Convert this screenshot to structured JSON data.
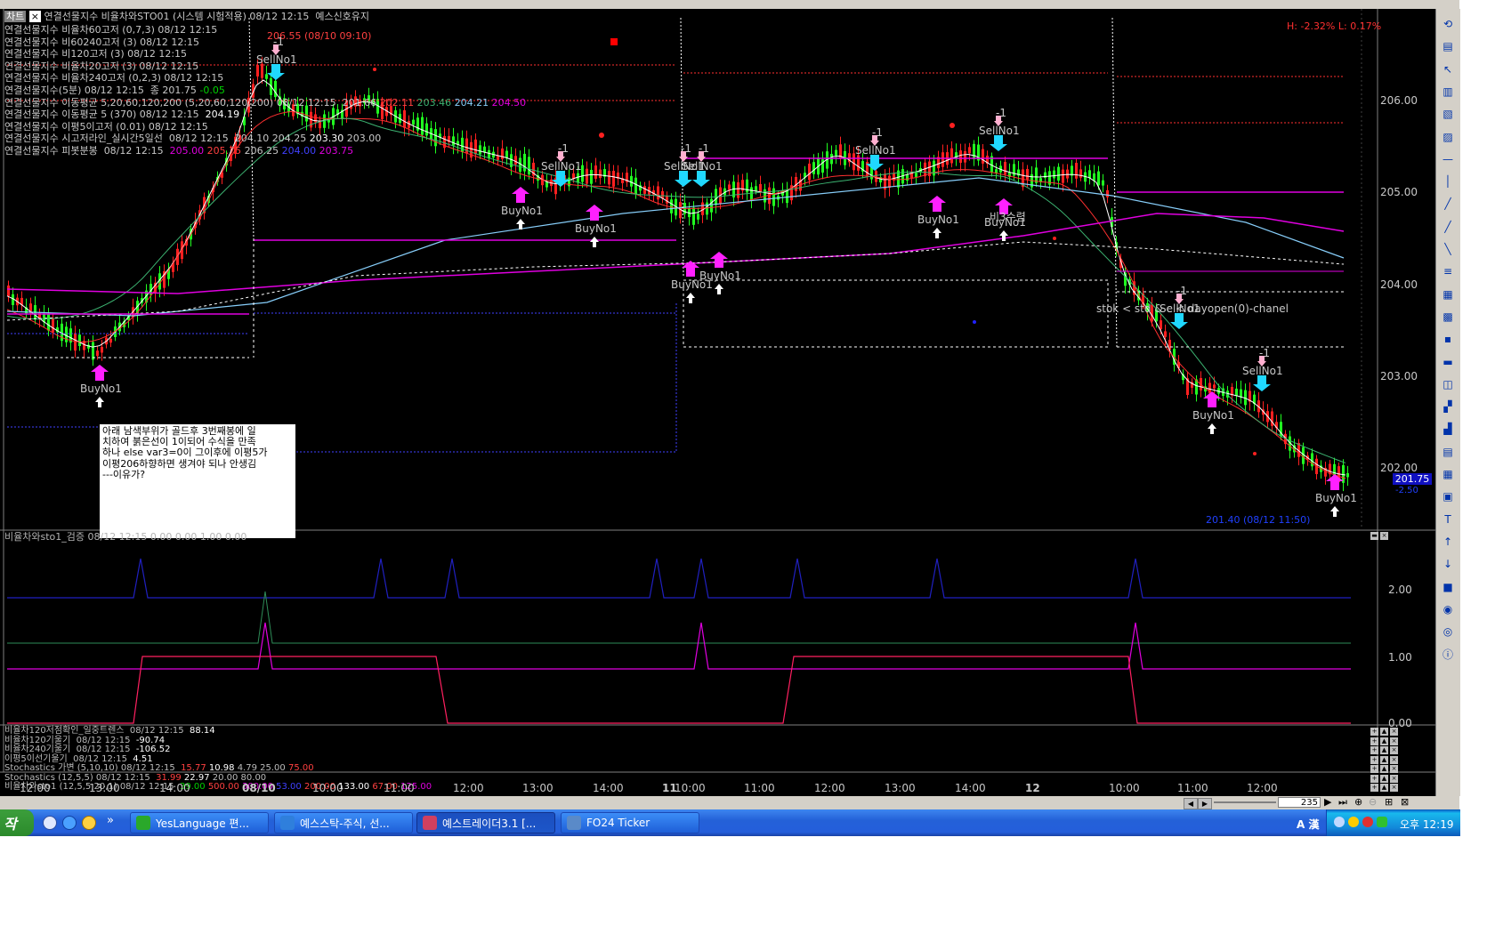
{
  "window": {
    "title_tab": "차트",
    "title_text": "연결선물지수 비율차와STO01 (시스템 시험적용) 08/12 12:15  예스신호유지"
  },
  "legend": [
    {
      "parts": [
        {
          "text": "연결선물지수 비율차60고저 (0,7,3) 08/12 12:15",
          "color": "#c8c8c8"
        }
      ]
    },
    {
      "parts": [
        {
          "text": "연결선물지수 비60240고저 (3) 08/12 12:15",
          "color": "#c8c8c8"
        }
      ]
    },
    {
      "parts": [
        {
          "text": "연결선물지수 비120고저 (3) 08/12 12:15",
          "color": "#c8c8c8"
        }
      ]
    },
    {
      "parts": [
        {
          "text": "연결선물지수 비율차20고저 (3) 08/12 12:15",
          "color": "#c8c8c8"
        }
      ]
    },
    {
      "parts": [
        {
          "text": "연결선물지수 비율차240고저 (0,2,3) 08/12 12:15",
          "color": "#c8c8c8"
        }
      ]
    },
    {
      "parts": [
        {
          "text": "연결선물지수(5분) 08/12 12:15  종 201.75 ",
          "color": "#c8c8c8"
        },
        {
          "text": "-0.05",
          "color": "#00d200"
        }
      ]
    },
    {
      "parts": [
        {
          "text": "연결선물지수 이동평균 5,20,60,120,200 (5,20,60,120,200) 08/12 12:15  201.66 ",
          "color": "#c8c8c8"
        },
        {
          "text": "202.11 ",
          "color": "#ff4040"
        },
        {
          "text": "203.46 ",
          "color": "#3cb371"
        },
        {
          "text": "204.21 ",
          "color": "#87cefa"
        },
        {
          "text": "204.50",
          "color": "#e000e0"
        }
      ]
    },
    {
      "parts": [
        {
          "text": "연결선물지수 이동평균 5 (370) 08/12 12:15  ",
          "color": "#c8c8c8"
        },
        {
          "text": "204.19",
          "color": "#ffffff"
        }
      ]
    },
    {
      "parts": [
        {
          "text": "연결선물지수 이평5이고저 (0.01) 08/12 12:15",
          "color": "#c8c8c8"
        }
      ]
    },
    {
      "parts": [
        {
          "text": "연결선물지수 시고저라인_실시간5일선  08/12 12:15  204.10 204.25 ",
          "color": "#c8c8c8"
        },
        {
          "text": "203.30 ",
          "color": "#ffffff"
        },
        {
          "text": "203.00",
          "color": "#c8c8c8"
        }
      ]
    },
    {
      "parts": [
        {
          "text": "연결선물지수 피봇분봉  08/12 12:15  ",
          "color": "#c8c8c8"
        },
        {
          "text": "205.00 ",
          "color": "#e000e0"
        },
        {
          "text": "205.75 ",
          "color": "#ff4040"
        },
        {
          "text": "206.25 ",
          "color": "#c8c8c8"
        },
        {
          "text": "204.00 ",
          "color": "#4040ff"
        },
        {
          "text": "203.75",
          "color": "#e000e0"
        }
      ]
    }
  ],
  "annotations": {
    "top_price": "206.55 (08/10 09:10)",
    "high_low": "H: -2.32%  L: 0.17%",
    "low_price": "201.40 (08/12 11:50)",
    "current_price": "201.75",
    "current_change": "-2.50",
    "channel_text": "stok < std & c < dayopen(0)-chanel",
    "stop_text": "비3수렴"
  },
  "note": {
    "lines": [
      "아래 남색부위가 골드후 3번째봉에 일",
      "치하여 붉은선이 1이되어 수식을 만족",
      "하나 else var3=0이 그이후에 이평5가",
      "이평206하향하면 생겨야 되나 안생김",
      "---이유가?"
    ]
  },
  "signals": [
    {
      "label": "SellNo1",
      "count": "-1"
    },
    {
      "label": "BuyNo1",
      "count": "1"
    }
  ],
  "price_axis": [
    "206.00",
    "205.00",
    "204.00",
    "203.00",
    "202.00"
  ],
  "indicator_pane": {
    "header": "비율차와sto1_검증  08/12 12:15  0.00  0.00  1.00  0.00",
    "axis": [
      "2.00",
      "1.00",
      "0.00"
    ]
  },
  "sub_rows": [
    {
      "parts": [
        {
          "text": "비율차120저점확인_일중트렌스  08/12 12:15  ",
          "color": "#bbbbbb"
        },
        {
          "text": "88.14",
          "color": "#ffffff"
        }
      ]
    },
    {
      "parts": [
        {
          "text": "비율차120기울기  08/12 12:15  ",
          "color": "#bbbbbb"
        },
        {
          "text": "-90.74",
          "color": "#ffffff"
        }
      ]
    },
    {
      "parts": [
        {
          "text": "비율차240기울기  08/12 12:15  ",
          "color": "#bbbbbb"
        },
        {
          "text": "-106.52",
          "color": "#ffffff"
        }
      ]
    },
    {
      "parts": [
        {
          "text": "이평5이선기울기  08/12 12:15  ",
          "color": "#bbbbbb"
        },
        {
          "text": "4.51",
          "color": "#ffffff"
        }
      ]
    },
    {
      "parts": [
        {
          "text": "Stochastics 가변 (5,10,10) 08/12 12:15  ",
          "color": "#bbbbbb"
        },
        {
          "text": "15.77 ",
          "color": "#ff4040"
        },
        {
          "text": "10.98 ",
          "color": "#ffffff"
        },
        {
          "text": "4.79 ",
          "color": "#bbbbbb"
        },
        {
          "text": "25.00 ",
          "color": "#bbbbbb"
        },
        {
          "text": "75.00",
          "color": "#ff4040"
        }
      ]
    },
    {
      "parts": [
        {
          "text": "Stochastics (12,5,5) 08/12 12:15  ",
          "color": "#bbbbbb"
        },
        {
          "text": "31.99 ",
          "color": "#ff4040"
        },
        {
          "text": "22.97 ",
          "color": "#ffffff"
        },
        {
          "text": "20.00 80.00",
          "color": "#bbbbbb"
        }
      ]
    },
    {
      "parts": [
        {
          "text": "비율차와sto1 (12,5,5,20,1) 08/12 12:15  ",
          "color": "#bbbbbb"
        },
        {
          "text": "39.00 ",
          "color": "#00d200"
        },
        {
          "text": "500.00 ",
          "color": "#ff4040"
        },
        {
          "text": "300.00 ",
          "color": "#e000e0"
        },
        {
          "text": "53.00 ",
          "color": "#4040ff"
        },
        {
          "text": "200.00 ",
          "color": "#ff4040"
        },
        {
          "text": "133.00 ",
          "color": "#ffffff"
        },
        {
          "text": "67.00 ",
          "color": "#ff4040"
        },
        {
          "text": "125.00",
          "color": "#e000e0"
        }
      ]
    }
  ],
  "time_axis": [
    "12:00",
    "13:00",
    "14:00",
    "08/10",
    "10:00",
    "11:00",
    "12:00",
    "13:00",
    "14:00",
    "11",
    "10:00",
    "11:00",
    "12:00",
    "13:00",
    "14:00",
    "12",
    "10:00",
    "11:00",
    "12:00"
  ],
  "zoom_value": "235",
  "taskbar": {
    "start": "작",
    "tasks": [
      {
        "label": "YesLanguage 편...",
        "icon": "yeslanguage-icon",
        "color": "#2aa82a",
        "active": false
      },
      {
        "label": "예스스탁-주식, 선...",
        "icon": "ie-icon",
        "color": "#2f7fdc",
        "active": false
      },
      {
        "label": "예스트레이더3.1 [...",
        "icon": "yestrader-icon",
        "color": "#d04060",
        "active": true
      },
      {
        "label": "FO24 Ticker",
        "icon": "ticker-icon",
        "color": "#5a8ac8",
        "active": false
      }
    ],
    "clock": "오후 12:19",
    "ime": "A 漢"
  },
  "colors": {
    "up_candle": "#ff2020",
    "down_candle": "#20ff20",
    "sell_arrow": "#20d8ff",
    "buy_arrow": "#ff20ff"
  }
}
